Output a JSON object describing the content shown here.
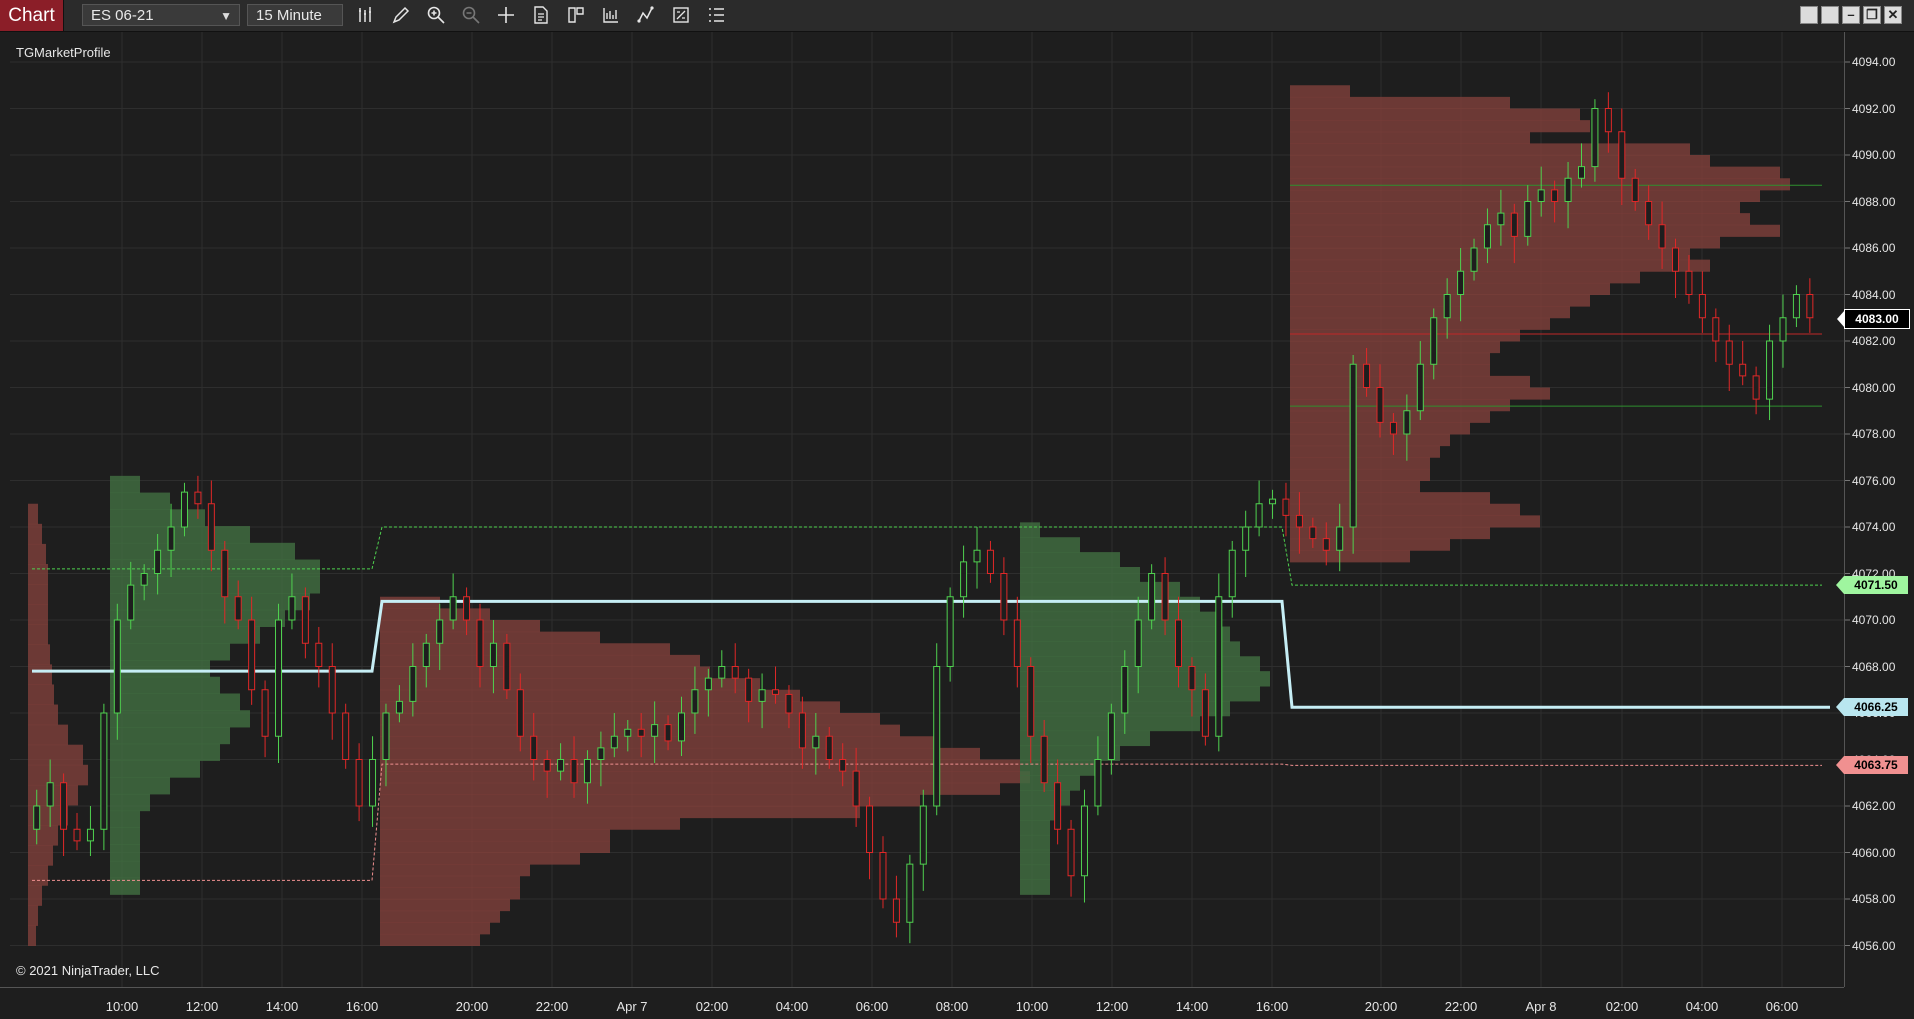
{
  "app": {
    "tag": "Chart",
    "instrument": "ES 06-21",
    "interval": "15 Minute"
  },
  "toolbar": {
    "tools": [
      "bar-type-icon",
      "pencil-icon",
      "zoom-in-icon",
      "zoom-out-icon",
      "crosshair-icon",
      "properties-icon",
      "strategies-icon",
      "indicators-icon",
      "drawing-tools-icon",
      "templates-icon"
    ]
  },
  "window": {
    "buttons": [
      "tile-icon",
      "tile2-icon",
      "minimize-icon",
      "restore-icon",
      "close-icon"
    ]
  },
  "chart": {
    "indicator": "TGMarketProfile",
    "copyright": "© 2021 NinjaTrader, LLC",
    "price_axis": [
      "4094.00",
      "4092.00",
      "4090.00",
      "4088.00",
      "4086.00",
      "4084.00",
      "4082.00",
      "4080.00",
      "4078.00",
      "4076.00",
      "4074.00",
      "4072.00",
      "4070.00",
      "4068.00",
      "4066.00",
      "4064.00",
      "4062.00",
      "4060.00",
      "4058.00",
      "4056.00"
    ],
    "time_axis": [
      "10:00",
      "12:00",
      "14:00",
      "16:00",
      "20:00",
      "22:00",
      "Apr 7",
      "02:00",
      "04:00",
      "06:00",
      "08:00",
      "10:00",
      "12:00",
      "14:00",
      "16:00",
      "20:00",
      "22:00",
      "Apr 8",
      "02:00",
      "04:00",
      "06:00"
    ],
    "flags": [
      {
        "label": "4083.00",
        "price": 4083.0,
        "color": "#000000",
        "text": "#ffffff"
      },
      {
        "label": "4071.50",
        "price": 4071.5,
        "color": "#9ff59f",
        "text": "#000000"
      },
      {
        "label": "4066.25",
        "price": 4066.25,
        "color": "#b9e6ef",
        "text": "#000000"
      },
      {
        "label": "4063.75",
        "price": 4063.75,
        "color": "#f09090",
        "text": "#000000"
      }
    ],
    "colors": {
      "background": "#1e1e1e",
      "grid": "#2e2e2e",
      "up": "#4fd14f",
      "down": "#e02828",
      "profile_red": "#7a3e3a",
      "profile_green": "#3f6b3f",
      "vwap": "#c6eef5"
    }
  }
}
